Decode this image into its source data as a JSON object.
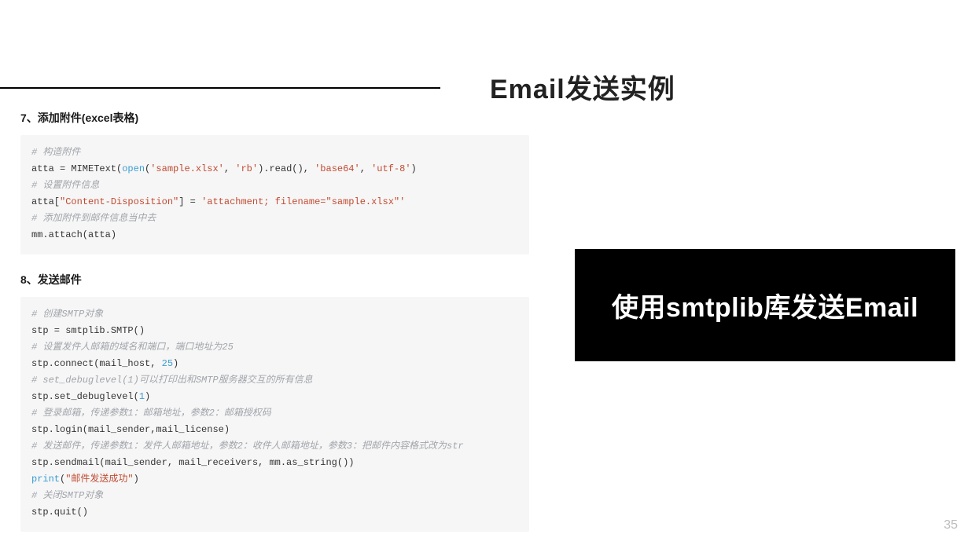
{
  "title": "Email发送实例",
  "section7_heading": "7、添加附件(excel表格)",
  "section8_heading": "8、发送邮件",
  "callout": "使用smtplib库发送Email",
  "pagenum": "35",
  "code1": {
    "c1": "# 构造附件",
    "l2_a": "atta = MIMEText(",
    "l2_fn": "open",
    "l2_b": "(",
    "l2_s1": "'sample.xlsx'",
    "l2_c": ", ",
    "l2_s2": "'rb'",
    "l2_d": ").read(), ",
    "l2_s3": "'base64'",
    "l2_e": ", ",
    "l2_s4": "'utf-8'",
    "l2_f": ")",
    "c3": "# 设置附件信息",
    "l4_a": "atta[",
    "l4_s1": "\"Content-Disposition\"",
    "l4_b": "] = ",
    "l4_s2": "'attachment; filename=\"sample.xlsx\"'",
    "c5": "# 添加附件到邮件信息当中去",
    "l6": "mm.attach(atta)"
  },
  "code2": {
    "c1": "# 创建SMTP对象",
    "l2": "stp = smtplib.SMTP()",
    "c3": "# 设置发件人邮箱的域名和端口，端口地址为25",
    "l4_a": "stp.connect(mail_host, ",
    "l4_n": "25",
    "l4_b": ")",
    "c5": "# set_debuglevel(1)可以打印出和SMTP服务器交互的所有信息",
    "l6_a": "stp.set_debuglevel(",
    "l6_n": "1",
    "l6_b": ")",
    "c7": "# 登录邮箱，传递参数1：邮箱地址，参数2：邮箱授权码",
    "l8": "stp.login(mail_sender,mail_license)",
    "c9": "# 发送邮件，传递参数1：发件人邮箱地址，参数2：收件人邮箱地址，参数3：把邮件内容格式改为str",
    "l10": "stp.sendmail(mail_sender, mail_receivers, mm.as_string())",
    "l11_fn": "print",
    "l11_a": "(",
    "l11_s": "\"邮件发送成功\"",
    "l11_b": ")",
    "c12": "# 关闭SMTP对象",
    "l13": "stp.quit()"
  }
}
